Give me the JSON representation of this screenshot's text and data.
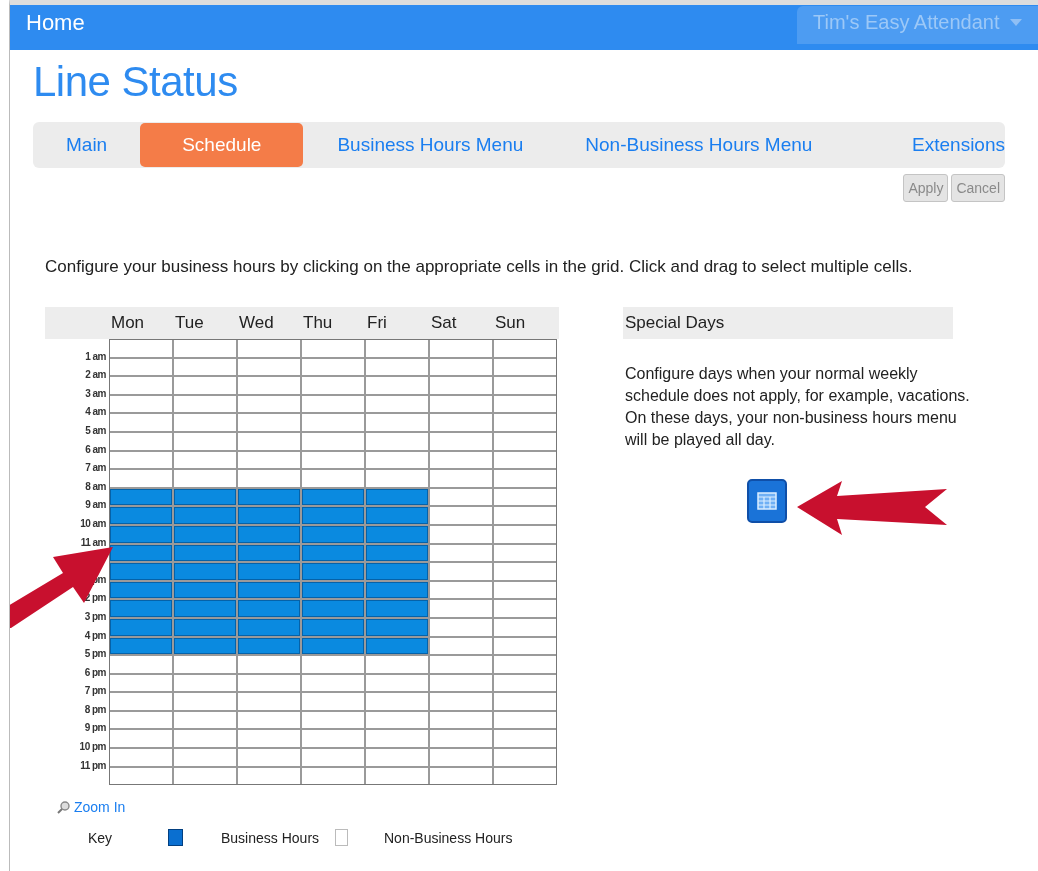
{
  "top_bar": {
    "home": "Home",
    "account_menu": "Tim's Easy Attendant"
  },
  "page_title": "Line Status",
  "tabs": [
    {
      "label": "Main",
      "selected": false
    },
    {
      "label": "Schedule",
      "selected": true
    },
    {
      "label": "Business Hours Menu",
      "selected": false
    },
    {
      "label": "Non-Business Hours Menu",
      "selected": false
    },
    {
      "label": "Extensions",
      "selected": false
    }
  ],
  "actions": [
    {
      "label": "Apply",
      "disabled": true
    },
    {
      "label": "Cancel",
      "disabled": true
    }
  ],
  "instructions": "Configure your business hours by clicking on the appropriate cells in the grid. Click and drag to select multiple cells.",
  "schedule": {
    "days": [
      "Mon",
      "Tue",
      "Wed",
      "Thu",
      "Fri",
      "Sat",
      "Sun"
    ],
    "rows": [
      {
        "cells": [
          false,
          false,
          false,
          false,
          false,
          false,
          false
        ]
      },
      {
        "label": "1 am",
        "cells": [
          false,
          false,
          false,
          false,
          false,
          false,
          false
        ]
      },
      {
        "label": "2 am",
        "cells": [
          false,
          false,
          false,
          false,
          false,
          false,
          false
        ]
      },
      {
        "label": "3 am",
        "cells": [
          false,
          false,
          false,
          false,
          false,
          false,
          false
        ]
      },
      {
        "label": "4 am",
        "cells": [
          false,
          false,
          false,
          false,
          false,
          false,
          false
        ]
      },
      {
        "label": "5 am",
        "cells": [
          false,
          false,
          false,
          false,
          false,
          false,
          false
        ]
      },
      {
        "label": "6 am",
        "cells": [
          false,
          false,
          false,
          false,
          false,
          false,
          false
        ]
      },
      {
        "label": "7 am",
        "cells": [
          false,
          false,
          false,
          false,
          false,
          false,
          false
        ]
      },
      {
        "label": "8 am",
        "cells": [
          true,
          true,
          true,
          true,
          true,
          false,
          false
        ]
      },
      {
        "label": "9 am",
        "cells": [
          true,
          true,
          true,
          true,
          true,
          false,
          false
        ]
      },
      {
        "label": "10 am",
        "cells": [
          true,
          true,
          true,
          true,
          true,
          false,
          false
        ]
      },
      {
        "label": "11 am",
        "cells": [
          true,
          true,
          true,
          true,
          true,
          false,
          false
        ]
      },
      {
        "cells": [
          true,
          true,
          true,
          true,
          true,
          false,
          false
        ]
      },
      {
        "label": "pm",
        "cells": [
          true,
          true,
          true,
          true,
          true,
          false,
          false
        ]
      },
      {
        "label": "2 pm",
        "cells": [
          true,
          true,
          true,
          true,
          true,
          false,
          false
        ]
      },
      {
        "label": "3 pm",
        "cells": [
          true,
          true,
          true,
          true,
          true,
          false,
          false
        ]
      },
      {
        "label": "4 pm",
        "cells": [
          true,
          true,
          true,
          true,
          true,
          false,
          false
        ]
      },
      {
        "label": "5 pm",
        "cells": [
          false,
          false,
          false,
          false,
          false,
          false,
          false
        ]
      },
      {
        "label": "6 pm",
        "cells": [
          false,
          false,
          false,
          false,
          false,
          false,
          false
        ]
      },
      {
        "label": "7 pm",
        "cells": [
          false,
          false,
          false,
          false,
          false,
          false,
          false
        ]
      },
      {
        "label": "8 pm",
        "cells": [
          false,
          false,
          false,
          false,
          false,
          false,
          false
        ]
      },
      {
        "label": "9 pm",
        "cells": [
          false,
          false,
          false,
          false,
          false,
          false,
          false
        ]
      },
      {
        "label": "10 pm",
        "cells": [
          false,
          false,
          false,
          false,
          false,
          false,
          false
        ]
      },
      {
        "label": "11 pm",
        "cells": [
          false,
          false,
          false,
          false,
          false,
          false,
          false
        ]
      }
    ],
    "zoom_link": "Zoom In",
    "key": {
      "title": "Key",
      "business": "Business Hours",
      "non_business": "Non-Business Hours"
    }
  },
  "special_days": {
    "title": "Special Days",
    "description": "Configure days when your normal weekly schedule does not apply, for example, vacations. On these days, your non-business hours menu will be played all day."
  }
}
